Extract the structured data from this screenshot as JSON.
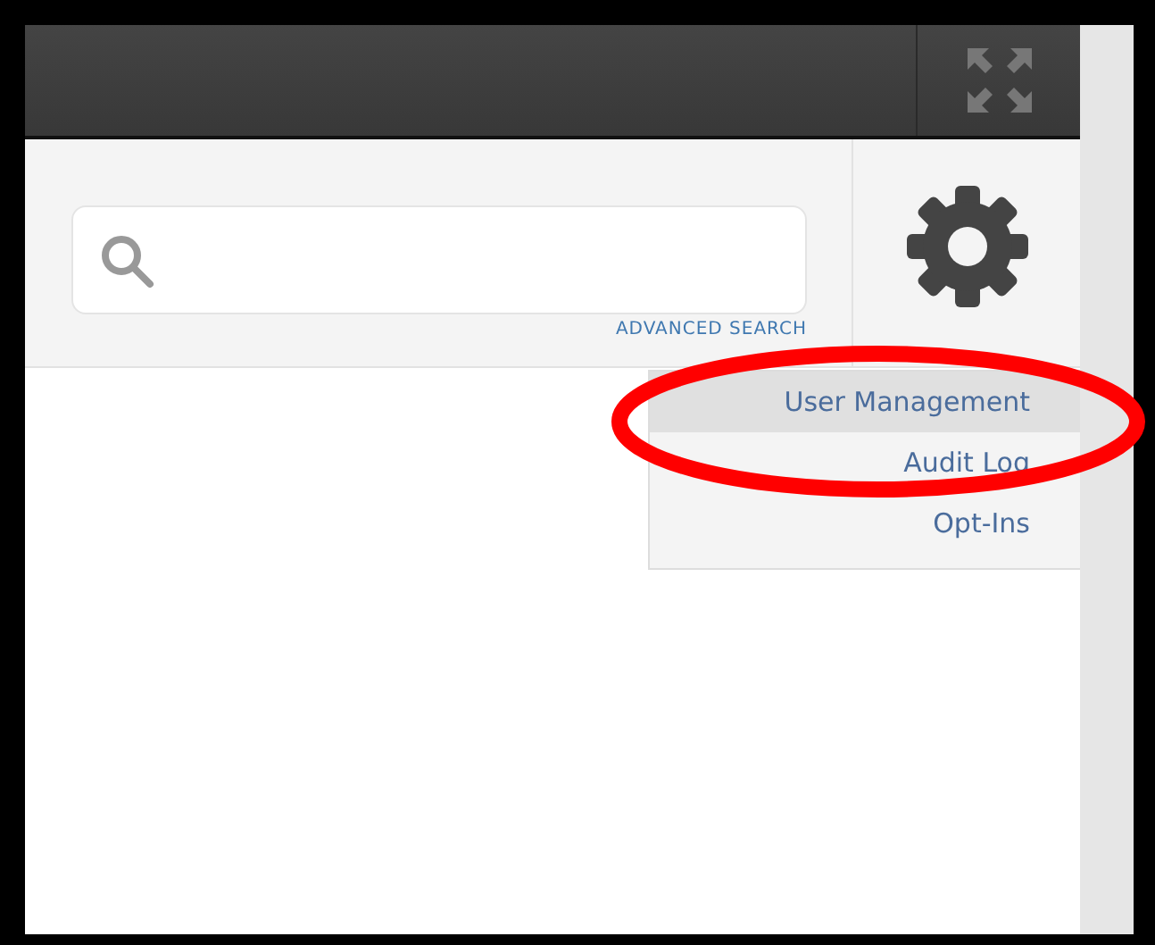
{
  "search": {
    "advanced_link": "ADVANCED SEARCH"
  },
  "settings_menu": {
    "items": [
      {
        "label": "User Management",
        "selected": true
      },
      {
        "label": "Audit Log",
        "selected": false
      },
      {
        "label": "Opt-Ins",
        "selected": false
      }
    ]
  },
  "annotation": {
    "kind": "ellipse",
    "color": "#ff0000"
  }
}
